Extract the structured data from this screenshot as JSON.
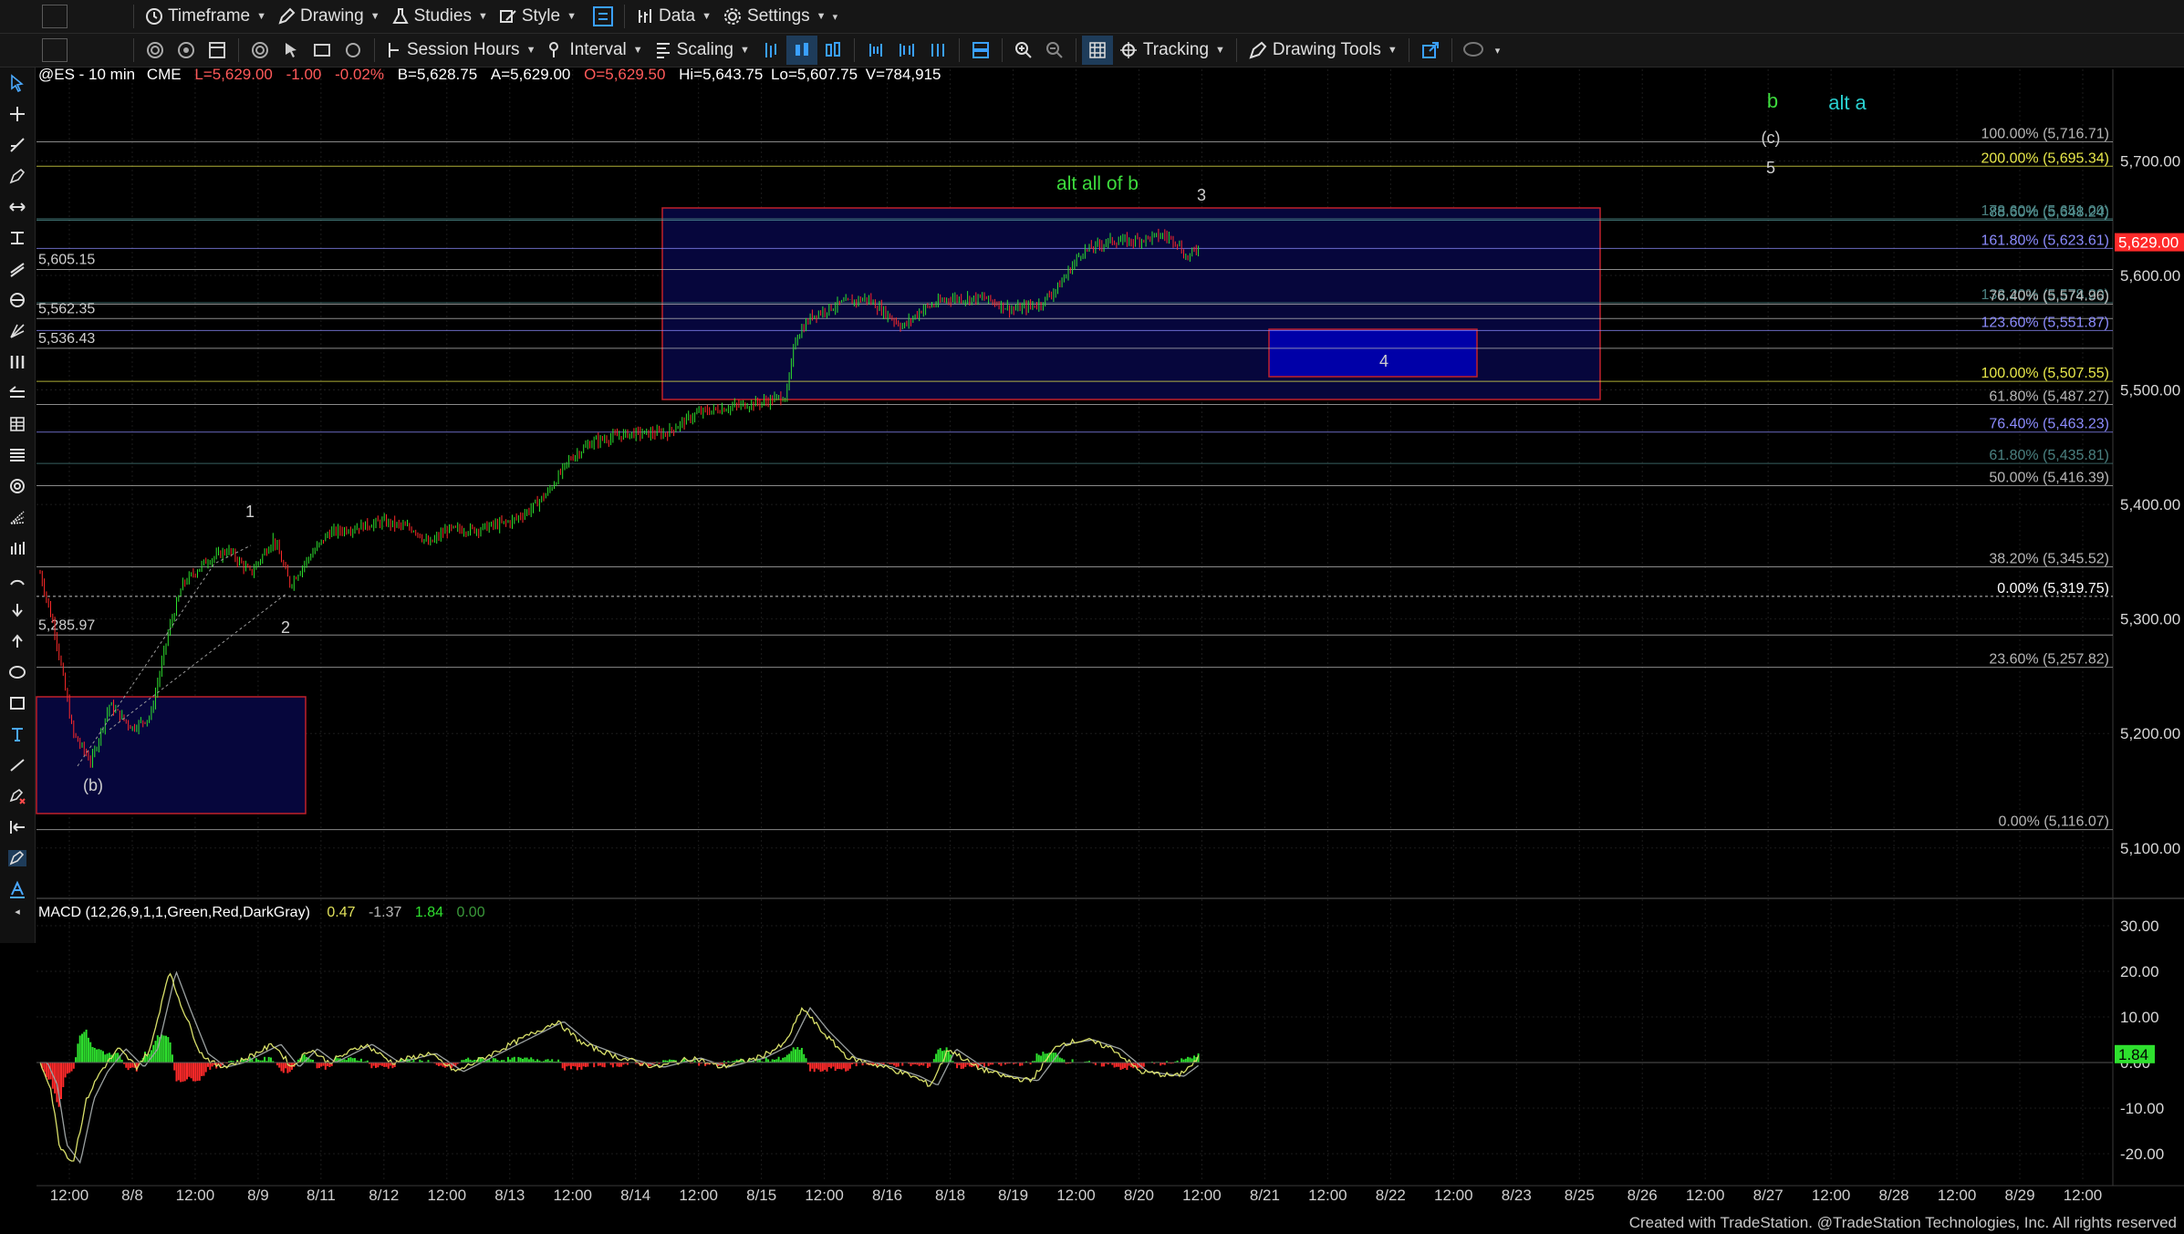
{
  "toolbar1": {
    "timeframe": "Timeframe",
    "drawing": "Drawing",
    "studies": "Studies",
    "style": "Style",
    "data": "Data",
    "settings": "Settings"
  },
  "toolbar2": {
    "session_hours": "Session Hours",
    "interval": "Interval",
    "scaling": "Scaling",
    "tracking": "Tracking",
    "drawing_tools": "Drawing Tools"
  },
  "symbol": {
    "name": "@ES - 10 min",
    "exchange": "CME",
    "last": "L=5,629.00",
    "change": "-1.00",
    "pct": "-0.02%",
    "bid": "B=5,628.75",
    "ask": "A=5,629.00",
    "open": "O=5,629.50",
    "high": "Hi=5,643.75",
    "low": "Lo=5,607.75",
    "volume": "V=784,915"
  },
  "macd": {
    "label": "MACD (12,26,9,1,1,Green,Red,DarkGray)",
    "v1": "0.47",
    "v2": "-1.37",
    "v3": "1.84",
    "v4": "0.00",
    "current_badge": "1.84"
  },
  "price_axis": {
    "ticks": [
      {
        "value": 5700,
        "label": "5,700.00"
      },
      {
        "value": 5600,
        "label": "5,600.00"
      },
      {
        "value": 5500,
        "label": "5,500.00"
      },
      {
        "value": 5400,
        "label": "5,400.00"
      },
      {
        "value": 5300,
        "label": "5,300.00"
      },
      {
        "value": 5200,
        "label": "5,200.00"
      },
      {
        "value": 5100,
        "label": "5,100.00"
      }
    ],
    "last_value": 5629,
    "last_label": "5,629.00",
    "range": [
      5060,
      5780
    ]
  },
  "macd_axis": {
    "ticks": [
      {
        "value": 30,
        "label": "30.00"
      },
      {
        "value": 20,
        "label": "20.00"
      },
      {
        "value": 10,
        "label": "10.00"
      },
      {
        "value": 0,
        "label": "0.00"
      },
      {
        "value": -10,
        "label": "-10.00"
      },
      {
        "value": -20,
        "label": "-20.00"
      }
    ],
    "range": [
      -25,
      33
    ]
  },
  "time_axis": [
    "12:00",
    "8/8",
    "12:00",
    "8/9",
    "8/11",
    "8/12",
    "12:00",
    "8/13",
    "12:00",
    "8/14",
    "12:00",
    "8/15",
    "12:00",
    "8/16",
    "8/18",
    "8/19",
    "12:00",
    "8/20",
    "12:00",
    "8/21",
    "12:00",
    "8/22",
    "12:00",
    "8/23",
    "8/25",
    "8/26",
    "12:00",
    "8/27",
    "12:00",
    "8/28",
    "12:00",
    "8/29",
    "12:00"
  ],
  "levels": [
    {
      "price": 5716.71,
      "label": "100.00% (5,716.71)",
      "color": "#b8b8b8"
    },
    {
      "price": 5695.34,
      "label": "200.00% (5,695.34)",
      "color": "#e8e84a"
    },
    {
      "price": 5648.24,
      "label": "88.60% (5,648.24)",
      "color": "#5aa0a0"
    },
    {
      "price": 5649.5,
      "label": "178.60% (5,651.00)",
      "color": "#4a8080"
    },
    {
      "price": 5623.61,
      "label": "161.80% (5,623.61)",
      "color": "#8c8cff"
    },
    {
      "price": 5605.15,
      "label": "",
      "color": "#b8b8b8"
    },
    {
      "price": 5576.2,
      "label": "138.20% (5,578.20)",
      "color": "#4a8080"
    },
    {
      "price": 5574.96,
      "label": "76.40% (5,574.96)",
      "color": "#b8b8b8"
    },
    {
      "price": 5562.35,
      "label": "",
      "color": "#b8b8b8"
    },
    {
      "price": 5551.87,
      "label": "123.60% (5,551.87)",
      "color": "#8c8cff"
    },
    {
      "price": 5536.43,
      "label": "",
      "color": "#b8b8b8"
    },
    {
      "price": 5507.55,
      "label": "100.00% (5,507.55)",
      "color": "#e8e84a"
    },
    {
      "price": 5487.27,
      "label": "61.80% (5,487.27)",
      "color": "#b8b8b8"
    },
    {
      "price": 5463.23,
      "label": "76.40% (5,463.23)",
      "color": "#8c8cff"
    },
    {
      "price": 5435.81,
      "label": "61.80% (5,435.81)",
      "color": "#4a8080"
    },
    {
      "price": 5416.39,
      "label": "50.00% (5,416.39)",
      "color": "#b8b8b8"
    },
    {
      "price": 5345.52,
      "label": "38.20% (5,345.52)",
      "color": "#b8b8b8"
    },
    {
      "price": 5319.75,
      "label": "0.00% (5,319.75)",
      "color": "#ffffff"
    },
    {
      "price": 5285.97,
      "label": "",
      "color": "#b8b8b8"
    },
    {
      "price": 5257.82,
      "label": "23.60% (5,257.82)",
      "color": "#b8b8b8"
    },
    {
      "price": 5116.07,
      "label": "0.00% (5,116.07)",
      "color": "#b8b8b8"
    }
  ],
  "left_price_labels": [
    "5,605.15",
    "5,562.35",
    "5,536.43",
    "5,285.97"
  ],
  "wave_labels": [
    {
      "text": "b",
      "color": "#3ddc3d"
    },
    {
      "text": "alt a",
      "color": "#2ad0d0"
    },
    {
      "text": "(c)",
      "color": "#cfcfcf"
    },
    {
      "text": "5",
      "color": "#cfcfcf"
    },
    {
      "text": "alt all of b",
      "color": "#3ddc3d"
    },
    {
      "text": "3",
      "color": "#cfcfcf"
    },
    {
      "text": "4",
      "color": "#cfcfcf"
    },
    {
      "text": "1",
      "color": "#cfcfcf"
    },
    {
      "text": "2",
      "color": "#cfcfcf"
    },
    {
      "text": "(b)",
      "color": "#cfcfcf"
    }
  ],
  "footer": "Created with TradeStation. @TradeStation Technologies, Inc. All rights reserved",
  "colors": {
    "bull": "#2ee02e",
    "bear": "#ff2a2a",
    "macd_line": "#d9e06a",
    "signal": "#9aa0a0"
  }
}
